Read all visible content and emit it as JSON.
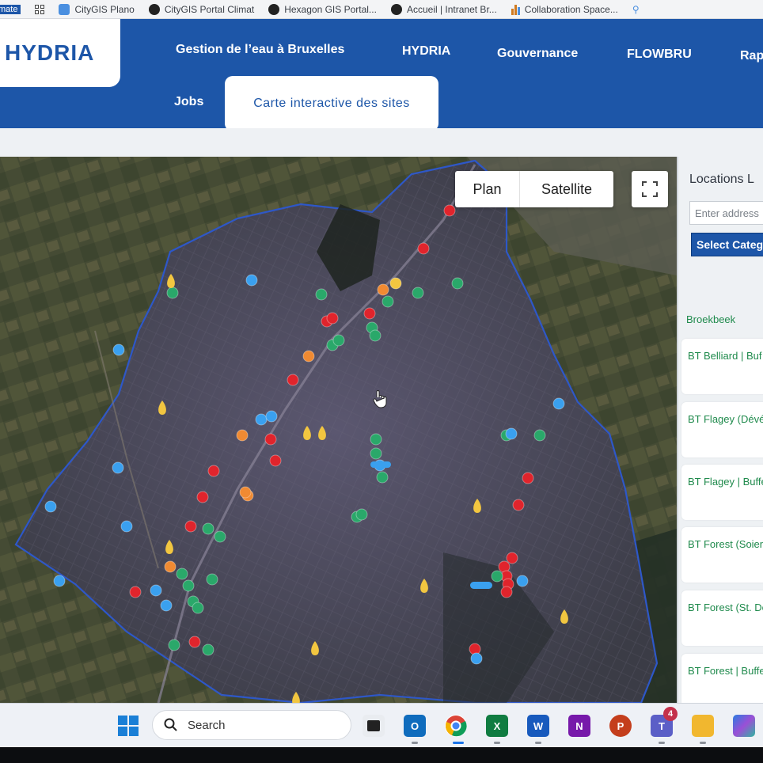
{
  "browser": {
    "bookmarks": [
      {
        "label": "mate",
        "icon": "app-icon",
        "color": "#1d56a8"
      },
      {
        "label": "",
        "icon": "apps-grid-icon",
        "color": "#444444"
      },
      {
        "label": "CityGIS Plano",
        "icon": "citygis-icon",
        "color": "#4a8fe0"
      },
      {
        "label": "CityGIS Portal Climat",
        "icon": "github-icon",
        "color": "#222222"
      },
      {
        "label": "Hexagon GIS Portal...",
        "icon": "globe-icon",
        "color": "#222222"
      },
      {
        "label": "Accueil | Intranet Br...",
        "icon": "intranet-icon",
        "color": "#222222"
      },
      {
        "label": "Collaboration Space...",
        "icon": "chart-bars-icon",
        "color": "#d07a20"
      }
    ]
  },
  "site": {
    "logo": "HYDRIA",
    "nav": {
      "gestion": "Gestion de l’eau à Bruxelles",
      "hydria": "HYDRIA",
      "gouvernance": "Gouvernance",
      "flowbru": "FLOWBRU",
      "rap": "Rap",
      "jobs": "Jobs",
      "carte": "Carte interactive des sites"
    },
    "colors": {
      "brand": "#1d56a8",
      "accent_green": "#1f8a4c"
    }
  },
  "map": {
    "plan_label": "Plan",
    "satellite_label": "Satellite",
    "marker_colors": {
      "red": "#e0242c",
      "green": "#2aa86a",
      "blue": "#3aa0ef",
      "orange": "#f08a32",
      "yellow": "#f2c640"
    }
  },
  "sidebar": {
    "title": "Locations L",
    "address_placeholder": "Enter address",
    "category_button": "Select Catego",
    "locations": [
      "Broekbeek",
      "BT Belliard | Buf",
      "BT Flagey (Dévé",
      "BT Flagey | Buffe",
      "BT Forest (Soier",
      "BT Forest (St. De",
      "BT Forest | Buffe"
    ]
  },
  "taskbar": {
    "search_label": "Search",
    "teams_badge": "4",
    "apps": [
      "task-view-icon",
      "outlook-icon",
      "chrome-icon",
      "excel-icon",
      "word-icon",
      "onenote-icon",
      "powerpoint-icon",
      "teams-icon",
      "file-explorer-icon",
      "m365-icon"
    ]
  }
}
